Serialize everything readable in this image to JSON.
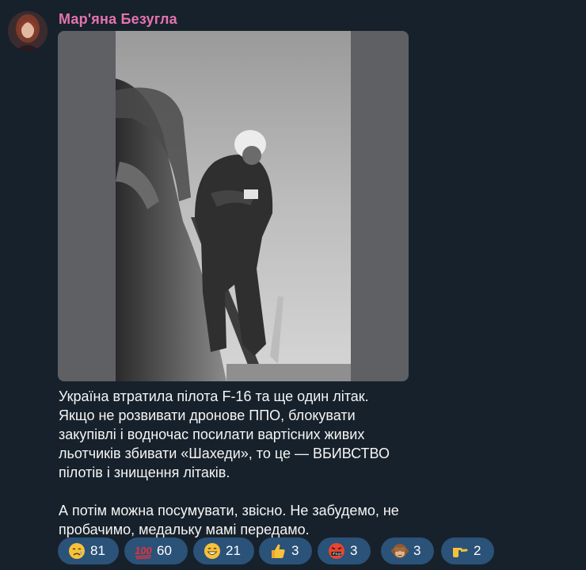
{
  "post": {
    "author": "Мар'яна Безугла",
    "avatar_icon": "author-avatar",
    "text_paragraphs": [
      "Україна втратила пілота F-16 та ще один літак. Якщо не розвивати дронове ППО, блокувати закупівлі і водночас посилати вартісних живих льотчиків збивати «Шахеди», то це — ВБИВСТВО пілотів і знищення літаків.",
      "А потім можна посумувати, звісно. Не забудемо, не пробачимо, медальку мамі передамо."
    ]
  },
  "colors": {
    "background": "#17212b",
    "author": "#e573b0",
    "reaction_bg": "#2b5278",
    "text": "#f5f5f5"
  },
  "reactions": [
    {
      "icon": "crying-face-icon",
      "count": "81"
    },
    {
      "icon": "hundred-points-icon",
      "count": "60"
    },
    {
      "icon": "grinning-face-icon",
      "count": "21"
    },
    {
      "icon": "thumbs-up-icon",
      "count": "3"
    },
    {
      "icon": "swearing-face-icon",
      "count": "3"
    },
    {
      "icon": "see-no-evil-monkey-icon",
      "count": "3"
    },
    {
      "icon": "pointing-hand-icon",
      "count": "2"
    }
  ]
}
